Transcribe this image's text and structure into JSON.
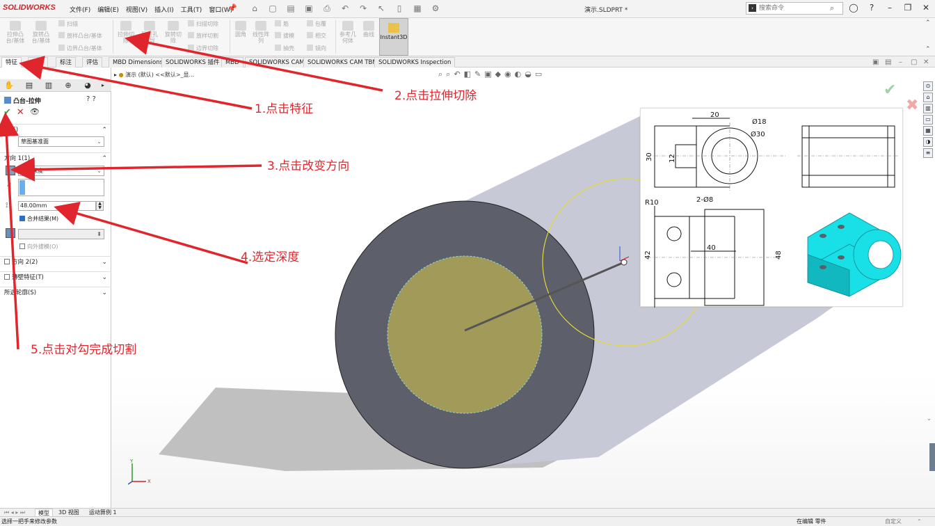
{
  "app": {
    "logo": "SOLIDWORKS",
    "document_title": "演示.SLDPRT *"
  },
  "menu": [
    "文件(F)",
    "编辑(E)",
    "视图(V)",
    "插入(I)",
    "工具(T)",
    "窗口(W)"
  ],
  "search": {
    "placeholder": "搜索命令"
  },
  "commands": {
    "extrude_boss": "拉伸凸\n台/基体",
    "revolve_boss": "旋转凸\n台/基体",
    "sweep": "扫描",
    "loft": "放样凸台/基体",
    "boundary_boss": "边界凸台/基体",
    "extrude_cut": "拉伸切\n除",
    "hole_wizard": "异型孔\n向导",
    "revolve_cut": "旋转切\n除",
    "swept_cut": "扫描切除",
    "lofted_cut": "放样切割",
    "boundary_cut": "边界切除",
    "fillet": "圆角",
    "linear_pattern": "线性阵\n列",
    "rib": "筋",
    "draft": "拔模",
    "shell": "抽壳",
    "wrap": "包覆",
    "intersect": "相交",
    "mirror": "镜向",
    "ref_geometry": "参考几\n何体",
    "curves": "曲线",
    "instant3d": "Instant3D"
  },
  "tabs": [
    "特征",
    "草图",
    "标注",
    "评估",
    "MBD Dimensions",
    "SOLIDWORKS 插件",
    "MBD",
    "SOLIDWORKS CAM",
    "SOLIDWORKS CAM TBM",
    "SOLIDWORKS Inspection"
  ],
  "property_manager": {
    "title": "凸台-拉伸",
    "from_label": "从(F)",
    "from_value": "草图基准面",
    "direction1_label": "方向 1(1)",
    "end_condition": "给定深度",
    "depth": "48.00mm",
    "merge_result": "合并结果(M)",
    "draft_outward": "向外拔模(O)",
    "direction2_label": "方向 2(2)",
    "thin_feature": "薄壁特征(T)",
    "selected_contours": "所选轮廓(S)"
  },
  "graphics": {
    "breadcrumb": "演示 (默认) <<默认>_显...",
    "axes": {
      "x": "X",
      "y": "Y",
      "z": "Z"
    }
  },
  "drawing": {
    "dim_20": "20",
    "dim_phi18": "Ø18",
    "dim_phi30": "Ø30",
    "dim_30": "30",
    "dim_12": "12",
    "dim_r10": "R10",
    "dim_2phi8": "2-Ø8",
    "dim_40": "40",
    "dim_42": "42",
    "dim_48": "48"
  },
  "annotations": {
    "step1": "1.点击特征",
    "step2": "2.点击拉伸切除",
    "step3": "3.点击改变方向",
    "step4": "4.选定深度",
    "step5": "5.点击对勾完成切割"
  },
  "bottom_tabs": [
    "模型",
    "3D 视图",
    "运动算例 1"
  ],
  "status": {
    "left": "选择一把手来修改参数",
    "editing": "在编辑 零件",
    "custom": "自定义"
  },
  "colors": {
    "accent_red": "#e0262c",
    "ok_green": "#2ea43a",
    "cylinder": "#c9cbd8",
    "face": "#5d5f6a",
    "sketch": "#a29a58",
    "iso_part": "#19dfe6"
  }
}
